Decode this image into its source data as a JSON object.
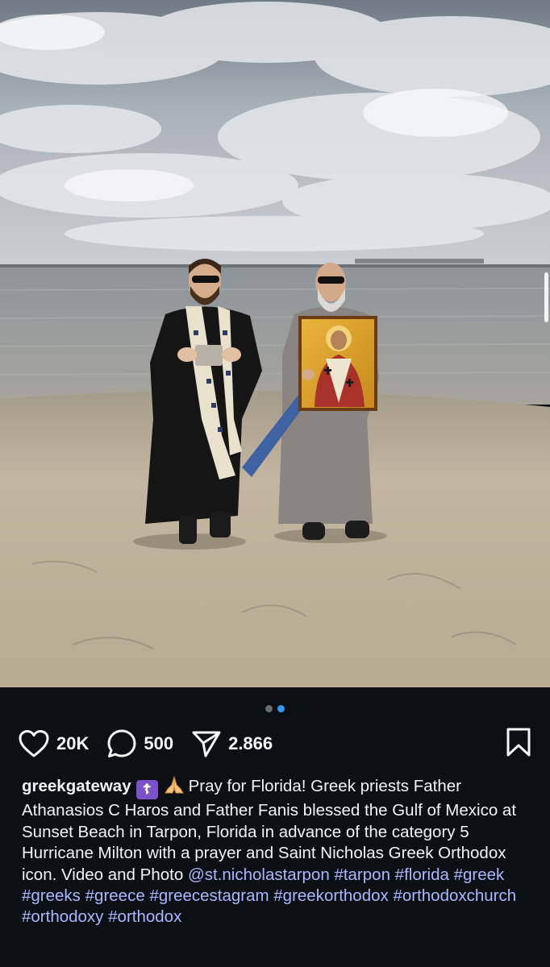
{
  "post": {
    "image_alt": "Two Greek Orthodox priests standing on the beach holding an icon of Saint Nicholas",
    "likes": "20K",
    "comments": "500",
    "shares": "2.866",
    "carousel": {
      "count": 2,
      "active_index": 1
    }
  },
  "caption": {
    "username": "greekgateway",
    "cross_emoji": "☦️",
    "text": "Pray for Florida! Greek priests Father Athanasios C Haros and Father Fanis blessed the Gulf of Mexico at Sunset Beach in Tarpon, Florida in advance of the category 5 Hurricane Milton with a prayer and Saint Nicholas Greek Orthodox icon. Video and Photo",
    "mention": "@st.nicholastarpon",
    "hashtags": [
      "#tarpon",
      "#florida",
      "#greek",
      "#greeks",
      "#greece",
      "#greecestagram",
      "#greekorthodox",
      "#orthodoxchurch",
      "#orthodoxy",
      "#orthodox"
    ]
  },
  "colors": {
    "background": "#0c1014",
    "hashtag": "#a7b8ff",
    "active_dot": "#3897f0",
    "cross_badge": "#7b52c9"
  },
  "icons": [
    "heart-icon",
    "comment-icon",
    "share-icon",
    "bookmark-icon",
    "pray-icon"
  ]
}
